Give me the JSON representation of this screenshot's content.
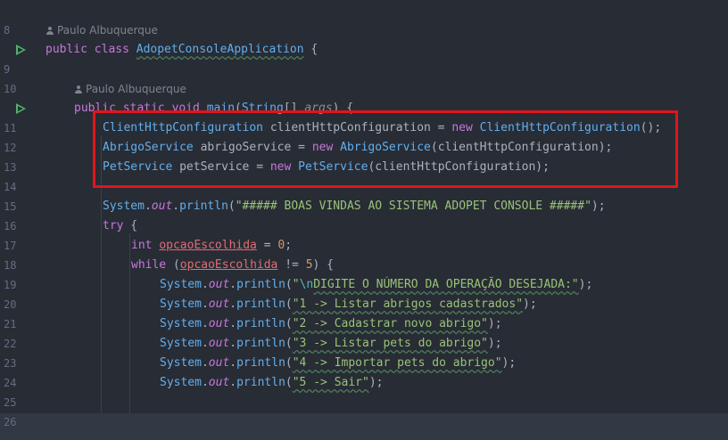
{
  "editor": {
    "author_hints": [
      {
        "text": "Paulo Albuquerque"
      },
      {
        "text": "Paulo Albuquerque"
      }
    ],
    "line_numbers": [
      "8",
      "9",
      "10",
      "11",
      "12",
      "13",
      "14",
      "15",
      "16",
      "17",
      "18",
      "19",
      "20",
      "21",
      "22",
      "23",
      "24",
      "25",
      "26"
    ],
    "lines": {
      "l9": {
        "kw": "public class ",
        "cls": "AdopetConsoleApplication",
        "rest": " {"
      },
      "l11": {
        "kw": "public static void ",
        "fn": "main",
        "rest1": "(",
        "type": "String",
        "rest2": "[] ",
        "param": "args",
        "rest3": ") {"
      },
      "l12": {
        "t1": "ClientHttpConfiguration",
        "t2": " clientHttpConfiguration = ",
        "kw": "new ",
        "t3": "ClientHttpConfiguration",
        "t4": "();"
      },
      "l13": {
        "t1": "AbrigoService",
        "t2": " abrigoService = ",
        "kw": "new ",
        "t3": "AbrigoService",
        "t4": "(clientHttpConfiguration);"
      },
      "l14": {
        "t1": "PetService",
        "t2": " petService = ",
        "kw": "new ",
        "t3": "PetService",
        "t4": "(clientHttpConfiguration);"
      },
      "l16": {
        "sys": "System",
        "dot1": ".",
        "out": "out",
        "dot2": ".",
        "fn": "println",
        "p1": "(",
        "str": "\"##### BOAS VINDAS AO SISTEMA ADOPET CONSOLE #####\"",
        "p2": ");"
      },
      "l17": {
        "kw": "try",
        "rest": " {"
      },
      "l18": {
        "kw": "int ",
        "var": "opcaoEscolhida",
        "rest": " = ",
        "num": "0",
        "end": ";"
      },
      "l19": {
        "kw": "while",
        "rest1": " (",
        "var": "opcaoEscolhida",
        "rest2": " != ",
        "num": "5",
        "rest3": ") {"
      },
      "l20": {
        "sys": "System",
        "out": "out",
        "fn": "println",
        "str1": "\"",
        "esc": "\\n",
        "str2": "DIGITE O NÚMERO DA OPERAÇÃO DESEJADA:\"",
        "end": ");"
      },
      "l21": {
        "sys": "System",
        "out": "out",
        "fn": "println",
        "str": "\"1 -> Listar abrigos cadastrados\"",
        "end": ");"
      },
      "l22": {
        "sys": "System",
        "out": "out",
        "fn": "println",
        "str": "\"2 -> Cadastrar novo abrigo\"",
        "end": ");"
      },
      "l23": {
        "sys": "System",
        "out": "out",
        "fn": "println",
        "str": "\"3 -> Listar pets do abrigo\"",
        "end": ");"
      },
      "l24": {
        "sys": "System",
        "out": "out",
        "fn": "println",
        "str": "\"4 -> Importar pets do abrigo\"",
        "end": ");"
      },
      "l25": {
        "sys": "System",
        "out": "out",
        "fn": "println",
        "str": "\"5 -> Sair\"",
        "end": ");"
      }
    },
    "icons": {
      "run": "run-icon",
      "author": "person-icon"
    },
    "colors": {
      "highlight": "#e3141b",
      "background": "#282c34"
    }
  }
}
